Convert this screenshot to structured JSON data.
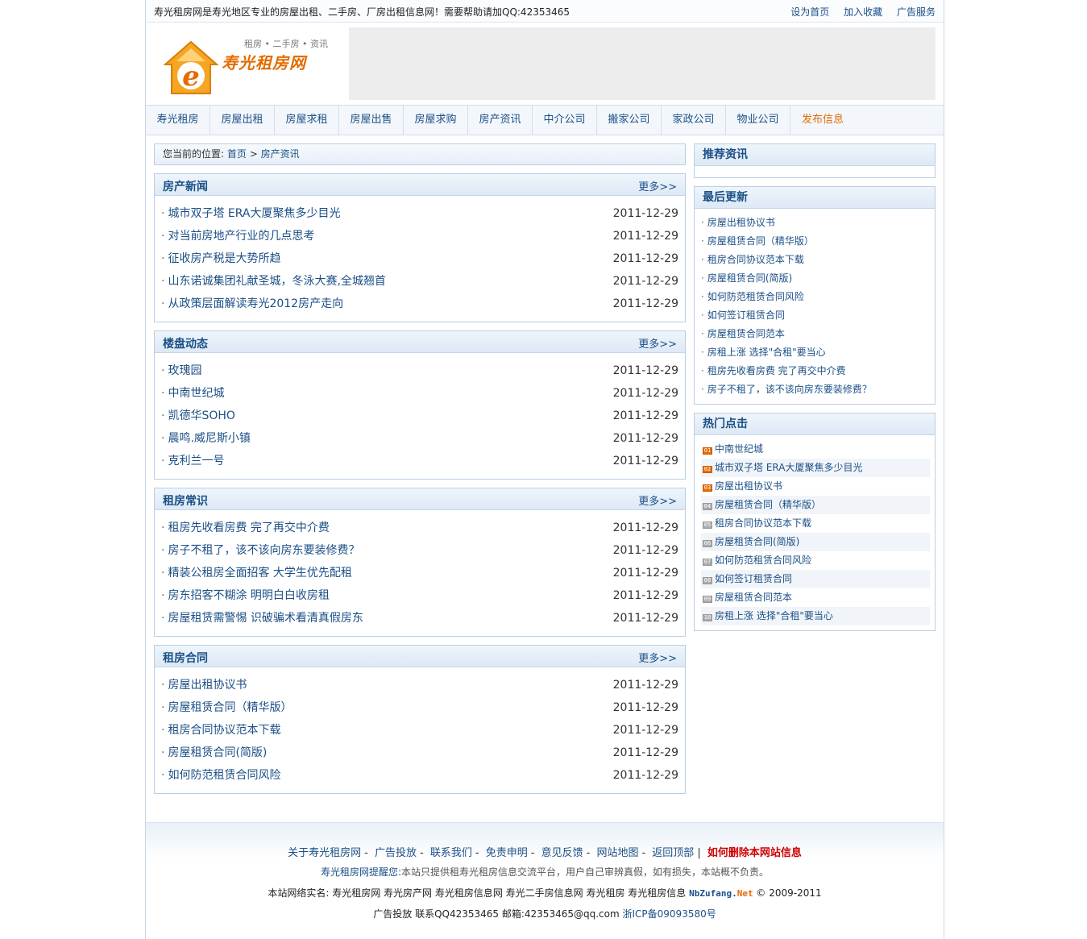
{
  "topbar": {
    "notice": "寿光租房网是寿光地区专业的房屋出租、二手房、厂房出租信息网！需要帮助请加QQ:42353465",
    "links": [
      "设为首页",
      "加入收藏",
      "广告服务"
    ]
  },
  "logo": {
    "tagline": "租房 • 二手房 • 资讯",
    "name": "寿光租房网"
  },
  "nav": [
    "寿光租房",
    "房屋出租",
    "房屋求租",
    "房屋出售",
    "房屋求购",
    "房产资讯",
    "中介公司",
    "搬家公司",
    "家政公司",
    "物业公司",
    "发布信息"
  ],
  "breadcrumb": {
    "prefix": "您当前的位置:",
    "home": "首页",
    "sep": ">",
    "current": "房产资讯"
  },
  "more_label": "更多>>",
  "sections": [
    {
      "title": "房产新闻",
      "items": [
        {
          "title": "城市双子塔 ERA大厦聚焦多少目光",
          "date": "2011-12-29"
        },
        {
          "title": "对当前房地产行业的几点思考",
          "date": "2011-12-29"
        },
        {
          "title": "征收房产税是大势所趋",
          "date": "2011-12-29"
        },
        {
          "title": "山东诺诚集团礼献圣城，冬泳大赛,全城翘首",
          "date": "2011-12-29"
        },
        {
          "title": "从政策层面解读寿光2012房产走向",
          "date": "2011-12-29"
        }
      ]
    },
    {
      "title": "楼盘动态",
      "items": [
        {
          "title": "玫瑰园",
          "date": "2011-12-29"
        },
        {
          "title": "中南世纪城",
          "date": "2011-12-29"
        },
        {
          "title": "凯德华SOHO",
          "date": "2011-12-29"
        },
        {
          "title": "晨鸣.威尼斯小镇",
          "date": "2011-12-29"
        },
        {
          "title": "克利兰一号",
          "date": "2011-12-29"
        }
      ]
    },
    {
      "title": "租房常识",
      "items": [
        {
          "title": "租房先收看房费 完了再交中介费",
          "date": "2011-12-29"
        },
        {
          "title": "房子不租了，该不该向房东要装修费？",
          "date": "2011-12-29"
        },
        {
          "title": "精装公租房全面招客 大学生优先配租",
          "date": "2011-12-29"
        },
        {
          "title": "房东招客不糊涂 明明白白收房租",
          "date": "2011-12-29"
        },
        {
          "title": "房屋租赁需警惕 识破骗术看清真假房东",
          "date": "2011-12-29"
        }
      ]
    },
    {
      "title": "租房合同",
      "items": [
        {
          "title": "房屋出租协议书",
          "date": "2011-12-29"
        },
        {
          "title": "房屋租赁合同（精华版）",
          "date": "2011-12-29"
        },
        {
          "title": "租房合同协议范本下载",
          "date": "2011-12-29"
        },
        {
          "title": "房屋租赁合同(简版)",
          "date": "2011-12-29"
        },
        {
          "title": "如何防范租赁合同风险",
          "date": "2011-12-29"
        }
      ]
    }
  ],
  "sidebar": {
    "recommend": {
      "title": "推荐资讯"
    },
    "latest": {
      "title": "最后更新",
      "items": [
        "房屋出租协议书",
        "房屋租赁合同（精华版）",
        "租房合同协议范本下载",
        "房屋租赁合同(简版)",
        "如何防范租赁合同风险",
        "如何签订租赁合同",
        "房屋租赁合同范本",
        "房租上涨 选择\"合租\"要当心",
        "租房先收看房费 完了再交中介费",
        "房子不租了，该不该向房东要装修费？"
      ]
    },
    "hot": {
      "title": "热门点击",
      "items": [
        {
          "rank": "01",
          "title": "中南世纪城"
        },
        {
          "rank": "02",
          "title": "城市双子塔 ERA大厦聚焦多少目光"
        },
        {
          "rank": "03",
          "title": "房屋出租协议书"
        },
        {
          "rank": "04",
          "title": "房屋租赁合同（精华版）"
        },
        {
          "rank": "05",
          "title": "租房合同协议范本下载"
        },
        {
          "rank": "06",
          "title": "房屋租赁合同(简版)"
        },
        {
          "rank": "07",
          "title": "如何防范租赁合同风险"
        },
        {
          "rank": "08",
          "title": "如何签订租赁合同"
        },
        {
          "rank": "09",
          "title": "房屋租赁合同范本"
        },
        {
          "rank": "10",
          "title": "房租上涨 选择\"合租\"要当心"
        }
      ]
    }
  },
  "footer": {
    "links": [
      "关于寿光租房网",
      "广告投放",
      "联系我们",
      "免责申明",
      "意见反馈",
      "网站地图",
      "返回顶部"
    ],
    "delete_link": "如何删除本网站信息",
    "note_brand": "寿光租房网提醒您:",
    "note_text": "本站只提供租寿光租房信息交流平台，用户自己审辨真假，如有损失，本站概不负责。",
    "domains_label": "本站网络实名:",
    "domains": "寿光租房网 寿光房产网 寿光租房信息网 寿光二手房信息网 寿光租房 寿光租房信息",
    "brand_main": "NbZufang.",
    "brand_tld": "Net",
    "copyright": "© 2009-2011",
    "contact": "广告投放 联系QQ42353465 邮箱:42353465@qq.com",
    "icp": "浙ICP备09093580号"
  }
}
